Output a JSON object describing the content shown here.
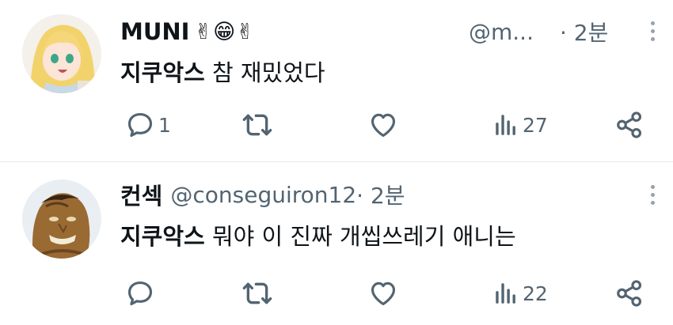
{
  "tweets": [
    {
      "name": "MUNI",
      "name_emoji": "✌😁✌",
      "handle": "@m...",
      "time": "· 2분",
      "hashtag": "지쿠악스",
      "text": " 참 재밌었다",
      "reply_count": "1",
      "retweet_count": "",
      "like_count": "",
      "view_count": "27"
    },
    {
      "name": "컨섹",
      "handle": "@conseguiron12",
      "time": " · 2분",
      "hashtag": "지쿠악스",
      "text": " 뭐야 이 진짜 개씹쓰레기 애니는",
      "reply_count": "",
      "retweet_count": "",
      "like_count": "",
      "view_count": "22"
    }
  ],
  "icons": {
    "reply": "speech-bubble-icon",
    "retweet": "retweet-arrows-icon",
    "like": "heart-icon",
    "views": "bar-chart-icon",
    "share": "share-nodes-icon",
    "more": "vertical-ellipsis-icon"
  },
  "colors": {
    "text_primary": "#0f1419",
    "text_secondary": "#536471",
    "divider": "#e7e9ea"
  }
}
